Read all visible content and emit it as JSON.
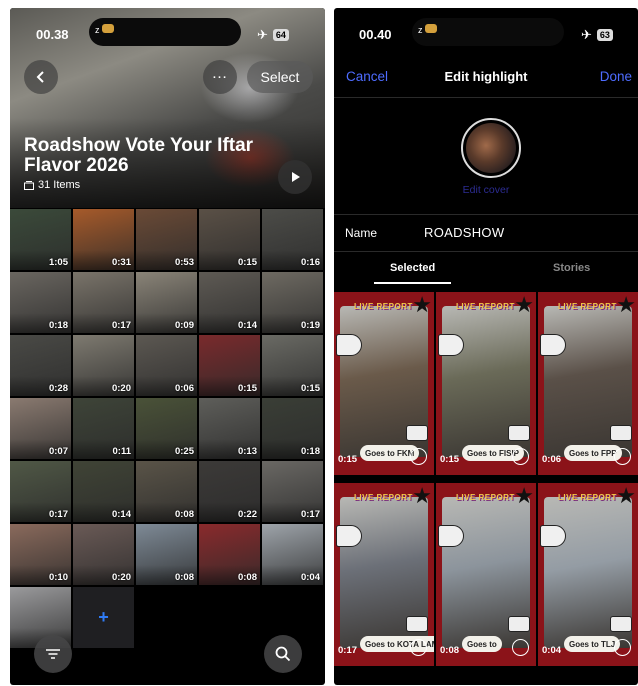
{
  "left": {
    "status": {
      "time": "00.38",
      "battery": "64"
    },
    "header": {
      "select_label": "Select"
    },
    "album": {
      "title": "Roadshow Vote Your Iftar Flavor 2026",
      "count": "31 Items"
    },
    "thumbnails": [
      {
        "duration": "1:05",
        "color": "#3b4a3a"
      },
      {
        "duration": "0:31",
        "color": "#a65a2a"
      },
      {
        "duration": "0:53",
        "color": "#6a4a36"
      },
      {
        "duration": "0:15",
        "color": "#5a5046"
      },
      {
        "duration": "0:16",
        "color": "#4c4c48"
      },
      {
        "duration": "0:18",
        "color": "#6a6660"
      },
      {
        "duration": "0:17",
        "color": "#7a746a"
      },
      {
        "duration": "0:09",
        "color": "#8a8478"
      },
      {
        "duration": "0:14",
        "color": "#5e5a54"
      },
      {
        "duration": "0:19",
        "color": "#6e6a62"
      },
      {
        "duration": "0:28",
        "color": "#4a4a46"
      },
      {
        "duration": "0:20",
        "color": "#7e7a70"
      },
      {
        "duration": "0:06",
        "color": "#5c5852"
      },
      {
        "duration": "0:15",
        "color": "#7a2a2c"
      },
      {
        "duration": "0:15",
        "color": "#6a6a64"
      },
      {
        "duration": "0:07",
        "color": "#8a7a70"
      },
      {
        "duration": "0:11",
        "color": "#3e4438"
      },
      {
        "duration": "0:25",
        "color": "#4a5238"
      },
      {
        "duration": "0:13",
        "color": "#5e5e5a"
      },
      {
        "duration": "0:18",
        "color": "#3a3e36"
      },
      {
        "duration": "0:17",
        "color": "#505846"
      },
      {
        "duration": "0:14",
        "color": "#404436"
      },
      {
        "duration": "0:08",
        "color": "#5a5448"
      },
      {
        "duration": "0:22",
        "color": "#3c3a38"
      },
      {
        "duration": "0:17",
        "color": "#6a6864"
      },
      {
        "duration": "0:10",
        "color": "#8a6a5c"
      },
      {
        "duration": "0:20",
        "color": "#6a5a56"
      },
      {
        "duration": "0:08",
        "color": "#7e8a96"
      },
      {
        "duration": "0:08",
        "color": "#8a2a2c"
      },
      {
        "duration": "0:04",
        "color": "#9ea4aa"
      },
      {
        "duration": "",
        "color": "#9a9a9c"
      }
    ],
    "add_label": "+"
  },
  "right": {
    "status": {
      "time": "00.40",
      "battery": "63"
    },
    "nav": {
      "cancel": "Cancel",
      "title": "Edit highlight",
      "done": "Done"
    },
    "edit_cover": "Edit cover",
    "name": {
      "label": "Name",
      "value": "ROADSHOW"
    },
    "tabs": [
      "Selected",
      "Stories"
    ],
    "stories": [
      {
        "duration": "0:15",
        "caption": "Goes to FKM",
        "photo": "#6a5a4a"
      },
      {
        "duration": "0:15",
        "caption": "Goes to FISIP",
        "photo": "#6a6a58"
      },
      {
        "duration": "0:06",
        "caption": "Goes to FPP",
        "photo": "#5a5048"
      },
      {
        "duration": "0:17",
        "caption": "Goes to KOTA LAMA",
        "photo": "#6c7078"
      },
      {
        "duration": "0:08",
        "caption": "Goes to",
        "photo": "#8c949c"
      },
      {
        "duration": "0:04",
        "caption": "Goes to TLJ",
        "photo": "#949ca4"
      }
    ],
    "story_header": "LIVE REPORT"
  }
}
